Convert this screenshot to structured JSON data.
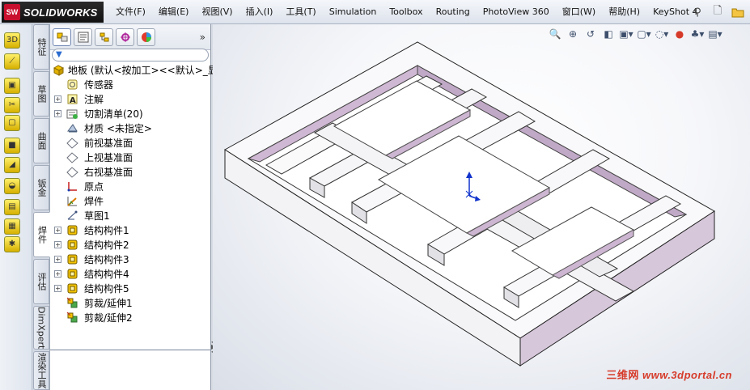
{
  "app": {
    "brand_badge": "SW",
    "brand_name": "SOLIDWORKS"
  },
  "menu": [
    "文件(F)",
    "编辑(E)",
    "视图(V)",
    "插入(I)",
    "工具(T)",
    "Simulation",
    "Toolbox",
    "Routing",
    "PhotoView 360",
    "窗口(W)",
    "帮助(H)",
    "KeyShot 4"
  ],
  "menu_right_icons": [
    "pin-icon",
    "new-document-icon",
    "open-folder-icon"
  ],
  "left_tools": [
    "3d-sketch-icon",
    "sketch-icon",
    "structural-member-icon",
    "trim-extend-icon",
    "end-cap-icon",
    "extruded-boss-icon",
    "gusset-icon",
    "fillet-bead-icon",
    "weldment-cut-icon",
    "cut-list-icon",
    "reference-geometry-icon"
  ],
  "vertical_tabs": [
    "特征",
    "草图",
    "曲面",
    "钣金",
    "焊件",
    "评估",
    "DimXpert",
    "渲染工具"
  ],
  "active_vertical_tab": "焊件",
  "panel_tabs": [
    "featuremanager-tab",
    "propertymanager-tab",
    "configurationmanager-tab",
    "dimxpert-tab",
    "display-manager-tab"
  ],
  "panel_more": "»",
  "tree": [
    {
      "label": "地板  (默认<按加工><<默认>_显",
      "icon": "part-icon",
      "level": 0,
      "expander": ""
    },
    {
      "label": "传感器",
      "icon": "sensor-icon",
      "level": 1,
      "expander": ""
    },
    {
      "label": "注解",
      "icon": "annotations-icon",
      "level": 1,
      "expander": "+"
    },
    {
      "label": "切割清单(20)",
      "icon": "cut-list-folder-icon",
      "level": 1,
      "expander": "+"
    },
    {
      "label": "材质 <未指定>",
      "icon": "material-icon",
      "level": 1,
      "expander": ""
    },
    {
      "label": "前视基准面",
      "icon": "plane-icon",
      "level": 1,
      "expander": ""
    },
    {
      "label": "上视基准面",
      "icon": "plane-icon",
      "level": 1,
      "expander": ""
    },
    {
      "label": "右视基准面",
      "icon": "plane-icon",
      "level": 1,
      "expander": ""
    },
    {
      "label": "原点",
      "icon": "origin-icon",
      "level": 1,
      "expander": ""
    },
    {
      "label": "焊件",
      "icon": "weldment-icon",
      "level": 1,
      "expander": ""
    },
    {
      "label": "草图1",
      "icon": "sketch-icon",
      "level": 1,
      "expander": ""
    },
    {
      "label": "结构构件1",
      "icon": "structural-member-icon",
      "level": 1,
      "expander": "+"
    },
    {
      "label": "结构构件2",
      "icon": "structural-member-icon",
      "level": 1,
      "expander": "+"
    },
    {
      "label": "结构构件3",
      "icon": "structural-member-icon",
      "level": 1,
      "expander": "+"
    },
    {
      "label": "结构构件4",
      "icon": "structural-member-icon",
      "level": 1,
      "expander": "+"
    },
    {
      "label": "结构构件5",
      "icon": "structural-member-icon",
      "level": 1,
      "expander": "+"
    },
    {
      "label": "剪裁/延伸1",
      "icon": "trim-extend-icon",
      "level": 1,
      "expander": ""
    },
    {
      "label": "剪裁/延伸2",
      "icon": "trim-extend-icon",
      "level": 1,
      "expander": ""
    }
  ],
  "view_toolbar": [
    "zoom-to-fit-icon",
    "zoom-to-area-icon",
    "previous-view-icon",
    "section-view-icon",
    "view-orientation-icon",
    "display-style-icon",
    "hide-show-icon",
    "edit-appearance-icon",
    "apply-scene-icon",
    "view-settings-icon"
  ],
  "watermark": {
    "cn": "三维网",
    "url": "www.3dportal.cn"
  },
  "colors": {
    "accent_red": "#c8102e",
    "frame_top": "#ffffff",
    "frame_inner": "#c8b2cc",
    "tab_active": "#ffffff"
  }
}
